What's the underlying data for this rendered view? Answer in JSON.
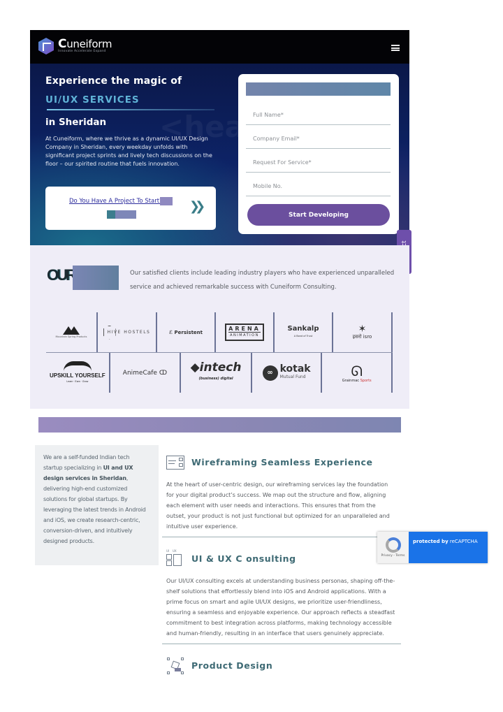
{
  "header": {
    "brand_initial": "C",
    "brand_rest": "uneiform",
    "tagline": "Innovate Accelerate Expand",
    "menu_icon": "hamburger-icon"
  },
  "hero": {
    "watermark": "<head",
    "title": "Experience the magic of",
    "services": "UI/UX SERVICES",
    "city": "in Sheridan",
    "description": "At Cuneiform, where we thrive as a dynamic UI/UX Design Company in Sheridan, every weekday unfolds with significant project sprints and lively tech discussions on the floor –  our spirited routine that fuels innovation.",
    "project_link": "Do You Have A Project To Start?",
    "project_arrow": "»",
    "form": {
      "fields": [
        {
          "name": "full-name",
          "placeholder": "Full Name*",
          "value": ""
        },
        {
          "name": "company-email",
          "placeholder": "Company Email*",
          "value": ""
        },
        {
          "name": "request-service",
          "placeholder": "Request For Service*",
          "value": ""
        },
        {
          "name": "mobile-no",
          "placeholder": "Mobile No.",
          "value": ""
        }
      ],
      "submit_label": "Start Developing"
    },
    "contact_tab": "Contact"
  },
  "clients": {
    "label": "OUR",
    "description": "Our satisfied clients include leading industry players who have experienced unparalleled service and achieved remarkable success with Cuneiform Consulting.",
    "row1": [
      {
        "name": "Mountain Spring Products",
        "text": "Mountain Spring Products"
      },
      {
        "name": "Hive Hostels",
        "text": "HIVE HOSTELS"
      },
      {
        "name": "Persistent",
        "text": "Persistent"
      },
      {
        "name": "Arena Animation",
        "text": "ARENA",
        "sub": "ANIMATION"
      },
      {
        "name": "Sankalp",
        "text": "Sankalp",
        "sub": "A Bond of Trust"
      },
      {
        "name": "ISRO",
        "text": "इसरो isro"
      }
    ],
    "row2": [
      {
        "name": "Upskill Yourself",
        "text": "UPSKILL YOURSELF",
        "sub": "Learn · Earn · Grow"
      },
      {
        "name": "AnimeCafe",
        "text": "AnimeCafe"
      },
      {
        "name": "Intech",
        "text": "intech",
        "sub": "(business) digital"
      },
      {
        "name": "Kotak Mutual Fund",
        "text": "kotak",
        "sub": "Mutual Fund"
      },
      {
        "name": "Grainmac Sports",
        "text": "Grainmac",
        "sub": "Sports"
      }
    ]
  },
  "intro": {
    "text_before": "We are a self-funded Indian tech startup specializing in ",
    "text_bold": "UI and UX design services in Sheridan",
    "text_after": ", delivering high-end customized solutions for global startups. By leveraging the latest trends in Android and iOS, we create research-centric, conversion-driven, and intuitively designed products."
  },
  "services": [
    {
      "icon": "wireframe-icon",
      "title": "Wireframing Seamless Experience",
      "description": "At the heart of user-centric design, our wireframing services lay the foundation for your digital product’s success. We map out the structure and flow, aligning each element with user needs and interactions. This ensures that from the outset, your product is not just functional but optimized for an unparalleled and intuitive user experience."
    },
    {
      "icon": "ui-ux-consulting-icon",
      "icon_labels": [
        "UI",
        "UX"
      ],
      "title": "UI & UX C onsulting",
      "description": "Our UI/UX consulting excels at understanding business personas, shaping off-the-shelf solutions that effortlessly blend into iOS and Android applications. With a prime focus on smart and agile UI/UX designs, we prioritize user-friendliness, ensuring a seamless and enjoyable experience. Our approach reflects a steadfast commitment to best integration across platforms, making technology accessible and human-friendly, resulting in an interface that users genuinely appreciate."
    },
    {
      "icon": "product-design-icon",
      "title": "Product Design",
      "description": ""
    }
  ],
  "recaptcha": {
    "protected_by": "protected by",
    "brand": "reCAPTCHA",
    "links": "Privacy - Terms"
  },
  "colors": {
    "header_bg": "#030306",
    "hero_bg": "#0d2366",
    "accent_purple": "#6b4f9e",
    "services_teal": "#5fb2d6",
    "service_title": "#3e6a74",
    "clients_bg": "#efedf7"
  }
}
